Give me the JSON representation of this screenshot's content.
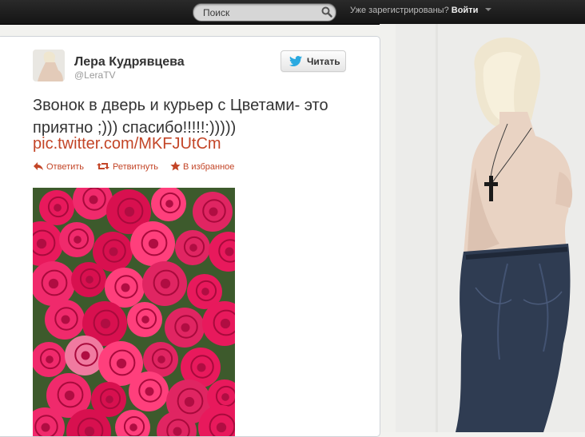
{
  "topbar": {
    "search_placeholder": "Поиск",
    "login_prompt": "Уже зарегистрированы?",
    "login_label": "Войти"
  },
  "tweet": {
    "user_name": "Лера Кудрявцева",
    "user_handle": "@LeraTV",
    "follow_label": "Читать",
    "text": "Звонок в дверь и курьер с Цветами- это приятно ;))) спасибо!!!!!:)))))",
    "link": "pic.twitter.com/MKFJUtCm",
    "actions": {
      "reply": "Ответить",
      "retweet": "Ретвитнуть",
      "favorite": "В избранное"
    }
  },
  "icons": [
    "search-icon",
    "caret-down-icon",
    "twitter-bird-icon",
    "reply-icon",
    "retweet-icon",
    "star-icon"
  ],
  "colors": {
    "link": "#c34527",
    "topbar": "#1f1f1f",
    "card": "#ffffff"
  }
}
